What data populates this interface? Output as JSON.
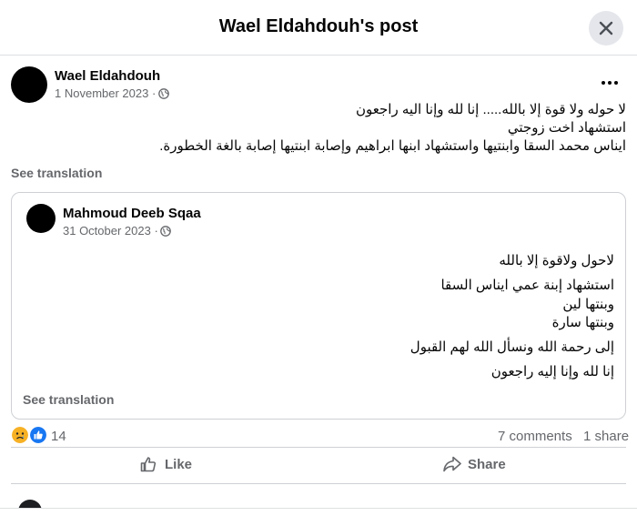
{
  "header": {
    "title": "Wael Eldahdouh's post"
  },
  "post": {
    "author": "Wael Eldahdouh",
    "date": "1 November 2023",
    "date_separator": "·",
    "lines": [
      "لا حوله ولا قوة إلا بالله..... إنا لله وإنا اليه راجعون",
      "استشهاد اخت زوجتي",
      "ايناس محمد السقا وابنتيها واستشهاد ابنها ابراهيم وإصابة ابنتيها إصابة بالغة الخطورة."
    ],
    "see_translation": "See translation"
  },
  "shared": {
    "author": "Mahmoud Deeb Sqaa",
    "date": "31 October 2023",
    "date_separator": "·",
    "lines": [
      "لاحول ولاقوة إلا بالله",
      "استشهاد إبنة عمي ايناس السقا",
      "وبنتها لين",
      "وبنتها سارة",
      "إلى رحمة الله ونسأل الله لهم القبول",
      "إنا لله وإنا إليه راجعون"
    ],
    "see_translation": "See translation"
  },
  "stats": {
    "reaction_count": "14",
    "comments": "7 comments",
    "shares": "1 share",
    "reaction_icons": [
      "sad-reaction-icon",
      "like-reaction-icon"
    ]
  },
  "actions": {
    "like": "Like",
    "share": "Share"
  },
  "colors": {
    "facebook_blue": "#1877f2",
    "sad_yellow": "#f7b125",
    "secondary_text": "#65676b"
  }
}
